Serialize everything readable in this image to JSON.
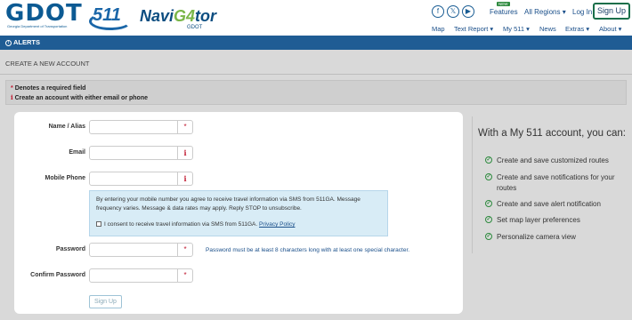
{
  "header": {
    "gdot_logo": "GDOT",
    "gdot_sub": "Georgia Department of Transportation",
    "logo_511": "511",
    "navigator_a": "Navi",
    "navigator_4": "G4",
    "navigator_b": "tor",
    "navigator_by": "GDOT",
    "social": [
      {
        "icon": "facebook-icon",
        "glyph": "f"
      },
      {
        "icon": "x-icon",
        "glyph": "𝕏"
      },
      {
        "icon": "youtube-icon",
        "glyph": "▶"
      }
    ],
    "new_badge": "NEW",
    "top_links": {
      "features": "Features",
      "regions": "All Regions ▾",
      "login": "Log In",
      "signup": "Sign Up"
    },
    "nav": [
      "Map",
      "Text Report ▾",
      "My 511 ▾",
      "News",
      "Extras ▾",
      "About ▾"
    ]
  },
  "alerts": {
    "label": "ALERTS"
  },
  "page": {
    "title": "CREATE A NEW ACCOUNT"
  },
  "notice": {
    "required_marker": "*",
    "required_text": "Denotes a required field",
    "info_marker": "i",
    "info_text": "Create an account with either email or phone"
  },
  "form": {
    "name_label": "Name / Alias",
    "email_label": "Email",
    "phone_label": "Mobile Phone",
    "sms_text": "By entering your mobile number you agree to receive travel information via SMS from 511GA. Message frequency varies. Message & data rates may apply. Reply STOP to unsubscribe.",
    "consent_text": "I consent to receive travel information via SMS from 511GA.",
    "privacy_link": "Privacy Policy",
    "password_label": "Password",
    "password_hint": "Password must be at least 8 characters long with at least one special character.",
    "confirm_label": "Confirm Password",
    "signup_button": "Sign Up",
    "required_marker": "*",
    "info_marker": "i"
  },
  "benefits": {
    "title": "With a My 511 account, you can:",
    "items": [
      "Create and save customized routes",
      "Create and save notifications for your routes",
      "Create and save alert notification",
      "Set map layer preferences",
      "Personalize camera view"
    ]
  },
  "colors": {
    "brand_blue": "#1f5c94",
    "required_red": "#c0172e",
    "check_green": "#2d8a3e"
  }
}
